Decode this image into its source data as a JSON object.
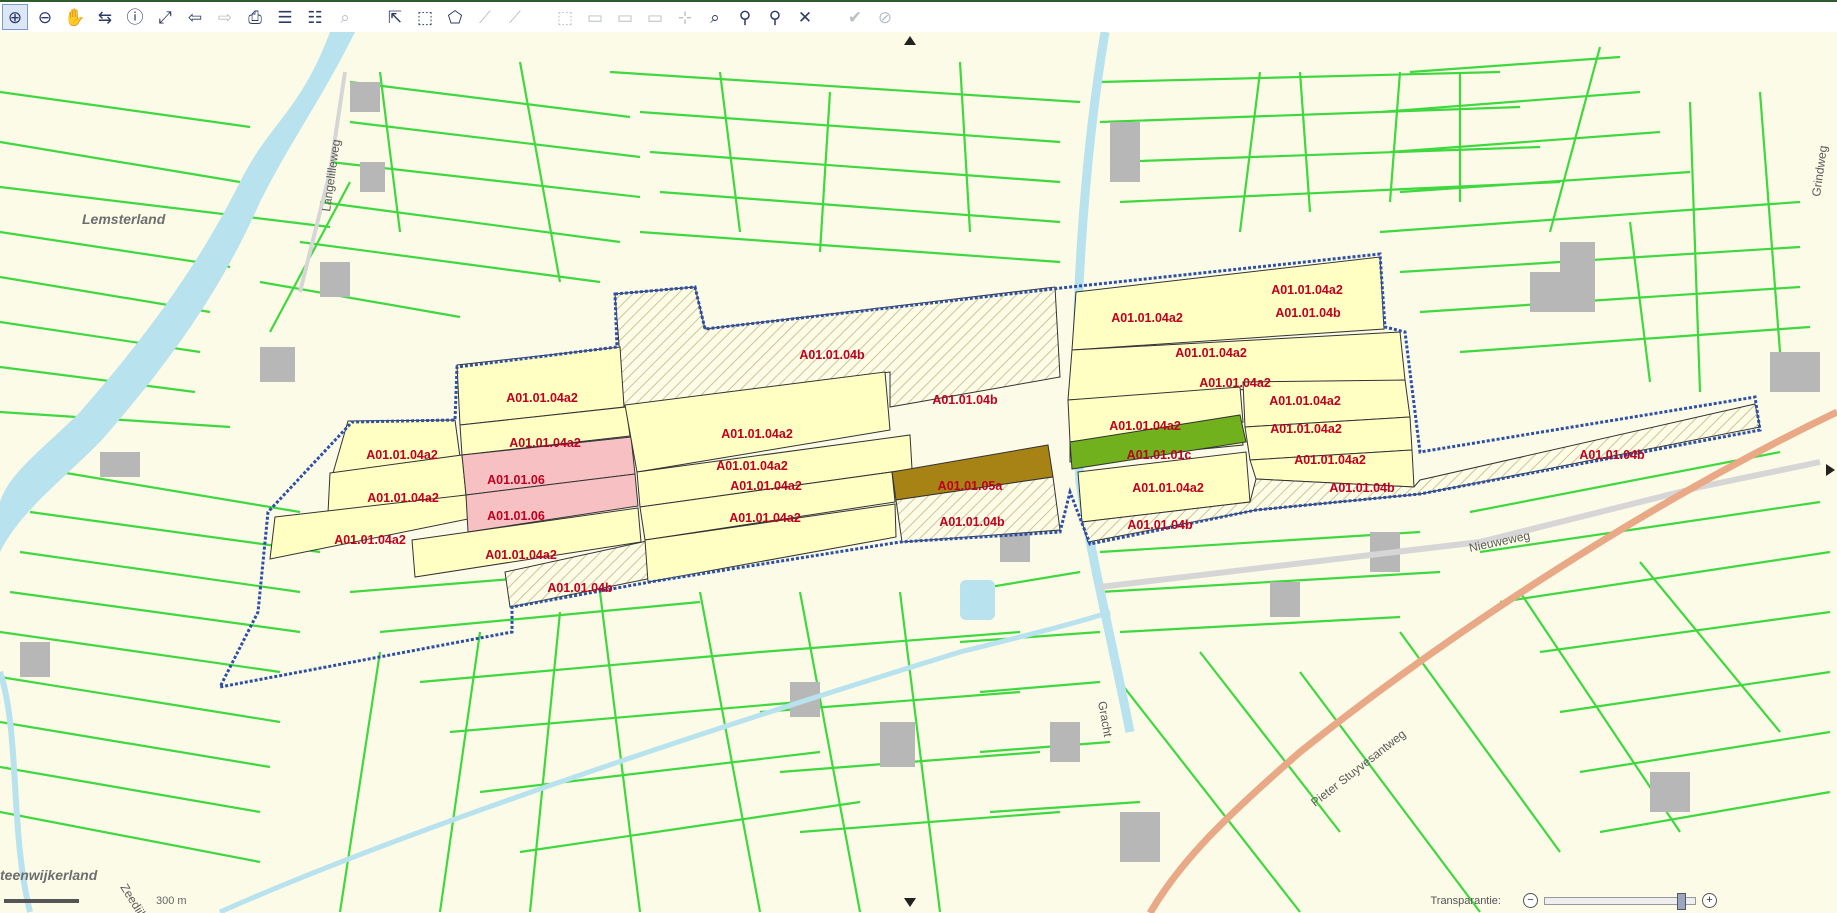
{
  "toolbar": {
    "tools": [
      {
        "name": "zoom-in-icon",
        "glyph": "⊕",
        "active": true
      },
      {
        "name": "zoom-out-icon",
        "glyph": "⊖"
      },
      {
        "name": "pan-hand-icon",
        "glyph": "✋"
      },
      {
        "name": "measure-icon",
        "glyph": "⇆"
      },
      {
        "name": "info-icon",
        "glyph": "ⓘ"
      },
      {
        "name": "full-extent-icon",
        "glyph": "⤢"
      },
      {
        "name": "back-icon",
        "glyph": "⇦"
      },
      {
        "name": "forward-icon",
        "glyph": "⇨",
        "disabled": true
      },
      {
        "name": "print-icon",
        "glyph": "⎙"
      },
      {
        "name": "legend-icon",
        "glyph": "☰"
      },
      {
        "name": "list-icon",
        "glyph": "☷"
      },
      {
        "name": "zoom-selection-icon",
        "glyph": "⌕",
        "disabled": true
      },
      {
        "name": "select-cursor-icon",
        "glyph": "⇱",
        "gap_before": true
      },
      {
        "name": "select-rectangle-icon",
        "glyph": "⬚"
      },
      {
        "name": "select-polygon-icon",
        "glyph": "⬠"
      },
      {
        "name": "select-line-icon",
        "glyph": "⟋",
        "disabled": true
      },
      {
        "name": "clear-selection-icon",
        "glyph": "⟋",
        "disabled": true
      },
      {
        "name": "draw-rectangle-icon",
        "glyph": "⬚",
        "disabled": true,
        "gap_before": true
      },
      {
        "name": "table-icon",
        "glyph": "▭",
        "disabled": true
      },
      {
        "name": "table-edit-icon",
        "glyph": "▭",
        "disabled": true
      },
      {
        "name": "table-view-icon",
        "glyph": "▭",
        "disabled": true
      },
      {
        "name": "split-icon",
        "glyph": "⊹",
        "disabled": true
      },
      {
        "name": "find-icon",
        "glyph": "⌕"
      },
      {
        "name": "magic-select-icon",
        "glyph": "⚲"
      },
      {
        "name": "magic-deselect-icon",
        "glyph": "⚲"
      },
      {
        "name": "close-x-icon",
        "glyph": "✕"
      },
      {
        "name": "confirm-check-icon",
        "glyph": "✔",
        "disabled": true,
        "gap_before": true
      },
      {
        "name": "cancel-circle-icon",
        "glyph": "⊘",
        "disabled": true
      }
    ]
  },
  "map": {
    "places": [
      "Lemsterland",
      "teenwijkerland"
    ],
    "roads": [
      "Langelilleweg",
      "Grindweg",
      "Nieuweweg",
      "Gracht",
      "Pieter Stuyvesantweg",
      "Zeedijk"
    ],
    "parcels": [
      {
        "code": "A01.01.04b",
        "type": "hatched"
      },
      {
        "code": "A01.01.04a2",
        "type": "yellow"
      },
      {
        "code": "A01.01.04b",
        "type": "hatched"
      },
      {
        "code": "A01.01.04a2",
        "type": "yellow"
      },
      {
        "code": "A01.01.04a2",
        "type": "yellow"
      },
      {
        "code": "A01.01.04a2",
        "type": "yellow"
      },
      {
        "code": "A01.01.06",
        "type": "pink"
      },
      {
        "code": "A01.01.04a2",
        "type": "yellow"
      },
      {
        "code": "A01.01.06",
        "type": "pink"
      },
      {
        "code": "A01.01.04a2",
        "type": "yellow"
      },
      {
        "code": "A01.01.04a2",
        "type": "yellow"
      },
      {
        "code": "A01.01.04b",
        "type": "hatched"
      },
      {
        "code": "A01.01.04a2",
        "type": "yellow"
      },
      {
        "code": "A01.01.04a2",
        "type": "yellow"
      },
      {
        "code": "A01.01.04a2",
        "type": "yellow"
      },
      {
        "code": "A01.01.05a",
        "type": "brown"
      },
      {
        "code": "A01.01.04b",
        "type": "hatched"
      },
      {
        "code": "A01.01.04a2",
        "type": "yellow"
      },
      {
        "code": "A01.01.04a2",
        "type": "yellow"
      },
      {
        "code": "A01.01.04b",
        "type": "yellow"
      },
      {
        "code": "A01.01.04a2",
        "type": "yellow"
      },
      {
        "code": "A01.01.04a2",
        "type": "yellow"
      },
      {
        "code": "A01.01.04a2",
        "type": "yellow"
      },
      {
        "code": "A01.01.04a2",
        "type": "yellow"
      },
      {
        "code": "A01.01.04a2",
        "type": "yellow"
      },
      {
        "code": "A01.01.01c",
        "type": "green"
      },
      {
        "code": "A01.01.04a2",
        "type": "yellow"
      },
      {
        "code": "A01.01.04a2",
        "type": "yellow"
      },
      {
        "code": "A01.01.04b",
        "type": "hatched"
      },
      {
        "code": "A01.01.04b",
        "type": "hatched"
      },
      {
        "code": "A01.01.04b",
        "type": "hatched"
      }
    ],
    "colors": {
      "background": "#fbfbe8",
      "parcel_lines": "#3fd83f",
      "water": "#b8e2ee",
      "yellow_parcel": "#ffffc4",
      "pink_parcel": "#f7c1c4",
      "brown_parcel": "#a68314",
      "green_parcel": "#71b11d",
      "boundary": "#2e4fa8",
      "label": "#c0001e",
      "railway": "#e9a886"
    }
  },
  "footer": {
    "scale_label": "300 m",
    "transparency_label": "Transparantie:",
    "transparency_value": 0.92
  }
}
